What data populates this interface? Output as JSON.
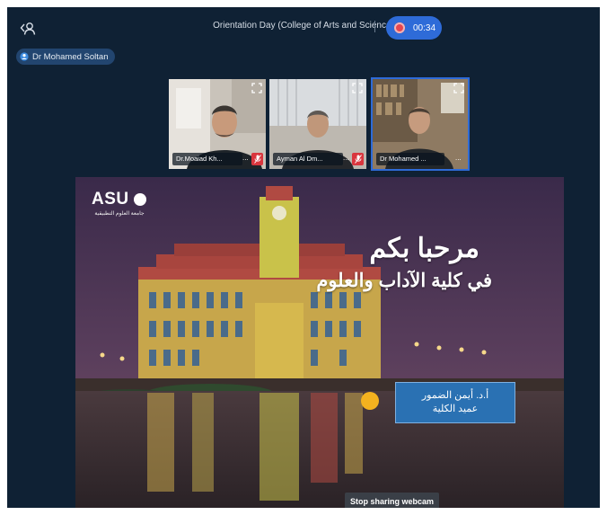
{
  "meeting": {
    "title": "Orientation Day (College of Arts and Science)",
    "recording_time": "00:34"
  },
  "presenter": {
    "name": "Dr Mohamed Soltan"
  },
  "participants": [
    {
      "label": "Dr.Moaiad Kh...",
      "more": "..."
    },
    {
      "label": "Ayman Al Dm...",
      "more": "..."
    },
    {
      "label": "Dr Mohamed ...",
      "more": "..."
    }
  ],
  "slide": {
    "logo_text": "ASU",
    "logo_subtitle": "جامعة العلوم التطبيقية",
    "welcome_line_1": "مرحبا بكم",
    "welcome_line_2": "في كلية الآداب والعلوم",
    "dean_name": "أ.د. أيمن الضمور",
    "dean_title": "عميد الكلية"
  },
  "actions": {
    "stop_webcam": "Stop sharing webcam"
  },
  "colors": {
    "app_bg": "#0f2134",
    "accent_blue": "#2e6bd8",
    "record_red": "#e64650",
    "mic_muted": "#d9363e",
    "dean_box": "#2a71b3",
    "slide_dot": "#f4b21f"
  },
  "icons": {
    "share": "share-screen-icon",
    "presenter": "presenter-icon",
    "expand": "expand-icon",
    "mic_muted": "mic-muted-icon"
  }
}
